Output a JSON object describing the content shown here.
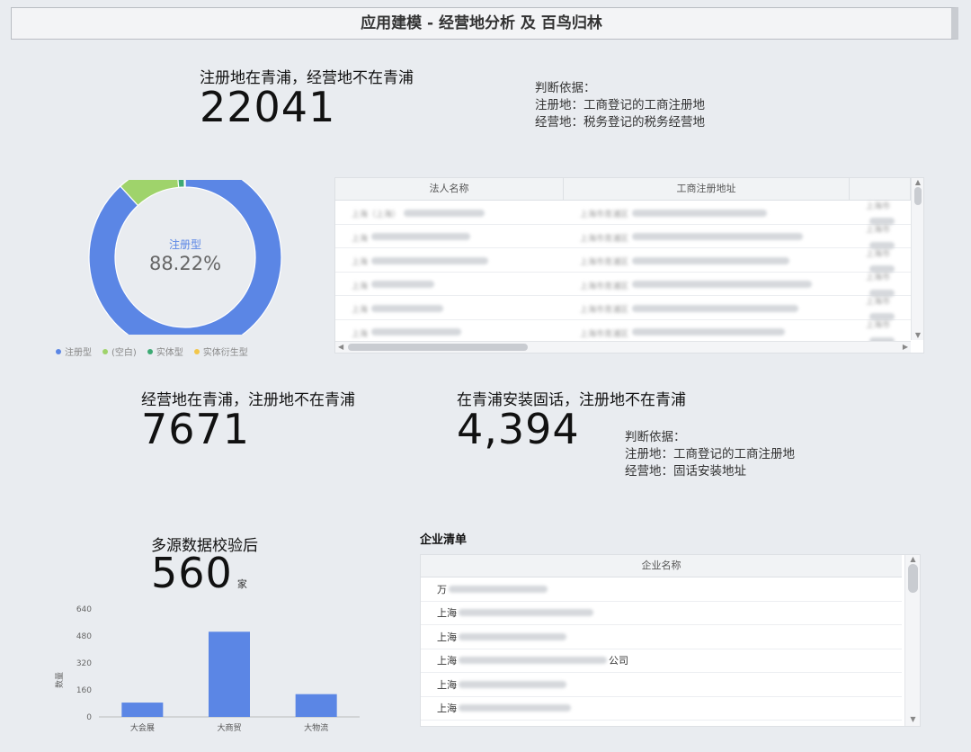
{
  "header": {
    "title": "应用建模 - 经营地分析 及 百鸟归林"
  },
  "kpi1": {
    "label": "注册地在青浦，经营地不在青浦",
    "value": "22041"
  },
  "basis1": {
    "title": "判断依据：",
    "line1": "注册地：工商登记的工商注册地",
    "line2": "经营地：税务登记的税务经营地"
  },
  "donut": {
    "center_label": "注册型",
    "center_value": "88.22%",
    "segments": [
      {
        "name": "注册型",
        "value": 88.22,
        "color": "#5b86e5"
      },
      {
        "name": "(空白)",
        "value": 10.3,
        "color": "#9fd36b"
      },
      {
        "name": "实体型",
        "value": 1.3,
        "color": "#3daa74"
      },
      {
        "name": "实体衍生型",
        "value": 0.18,
        "color": "#f2c64b"
      }
    ]
  },
  "table1": {
    "columns": [
      "法人名称",
      "工商注册地址",
      ""
    ],
    "rows": [
      [
        "上海（上海）",
        "上海市青浦区",
        "上海市"
      ],
      [
        "上海",
        "上海市青浦区",
        "上海市"
      ],
      [
        "上海",
        "上海市青浦区",
        "上海市"
      ],
      [
        "上海",
        "上海市青浦区",
        "上海市"
      ],
      [
        "上海",
        "上海市青浦区",
        "上海市"
      ],
      [
        "上海",
        "上海市青浦区",
        "上海市"
      ]
    ]
  },
  "kpi2": {
    "label": "经营地在青浦，注册地不在青浦",
    "value": "7671"
  },
  "kpi3": {
    "label": "在青浦安装固话，注册地不在青浦",
    "value": "4,394"
  },
  "basis2": {
    "title": "判断依据：",
    "line1": "注册地：工商登记的工商注册地",
    "line2": "经营地：固话安装地址"
  },
  "kpi4": {
    "label": "多源数据校验后",
    "value": "560",
    "unit": "家"
  },
  "chart_data": {
    "type": "bar",
    "categories": [
      "大会展",
      "大商贸",
      "大物流"
    ],
    "values": [
      85,
      505,
      135
    ],
    "ylabel": "数量",
    "yticks": [
      0,
      160,
      320,
      480,
      640
    ],
    "ylim": [
      0,
      640
    ],
    "color": "#5b86e5"
  },
  "companies": {
    "title": "企业清单",
    "column": "企业名称",
    "rows": [
      {
        "prefix": "万",
        "suffix": ""
      },
      {
        "prefix": "上海",
        "suffix": ""
      },
      {
        "prefix": "上海",
        "suffix": ""
      },
      {
        "prefix": "上海",
        "suffix": "公司"
      },
      {
        "prefix": "上海",
        "suffix": ""
      },
      {
        "prefix": "上海",
        "suffix": ""
      }
    ]
  }
}
